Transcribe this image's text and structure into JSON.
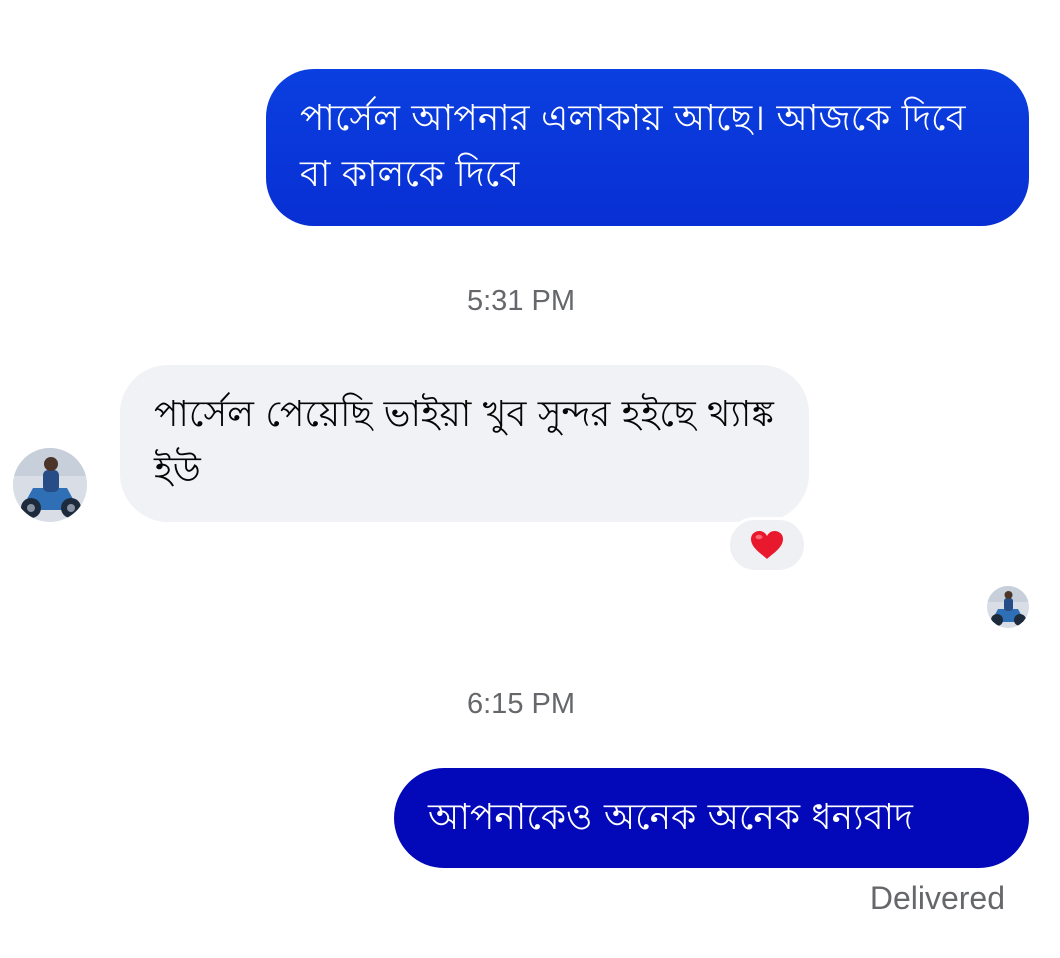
{
  "conversation": {
    "messages": [
      {
        "sender": "me",
        "text": "পার্সেল আপনার এলাকায় আছে। আজকে দিবে বা কালকে দিবে"
      },
      {
        "sender": "contact",
        "text": "পার্সেল পেয়েছি ভাইয়া খুব সুন্দর হইছে থ্যাঙ্ক ইউ"
      },
      {
        "sender": "me",
        "text": "আপনাকেও অনেক অনেক ধন্যবাদ"
      }
    ],
    "timestamps": [
      "5:31 PM",
      "6:15 PM"
    ],
    "reaction": {
      "icon": "heart-icon",
      "glyph": "❤️",
      "color": "#e8192c"
    },
    "status": "Delivered"
  },
  "colors": {
    "outgoing_bubble": "#0b3fe0",
    "outgoing_bubble_dark": "#0309b8",
    "incoming_bubble": "#f1f2f6",
    "meta_text": "#65676b"
  }
}
